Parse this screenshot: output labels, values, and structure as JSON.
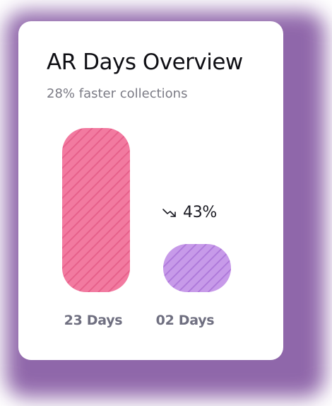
{
  "card": {
    "title": "AR Days Overview",
    "subtitle": "28% faster collections"
  },
  "icons": {
    "trend": "trend-down-icon"
  },
  "colors": {
    "bar1_fill": "#f27aa0",
    "bar1_stripe": "#e55d88",
    "bar2_fill": "#c79ae9",
    "bar2_stripe": "#ac76d9",
    "background_glow": "#8a5fa6"
  },
  "chart_data": {
    "type": "bar",
    "categories": [
      "23 Days",
      "02 Days"
    ],
    "values": [
      23,
      2
    ],
    "annotation": "43%",
    "ylim": [
      0,
      23
    ],
    "grid": false,
    "legend": "none"
  }
}
